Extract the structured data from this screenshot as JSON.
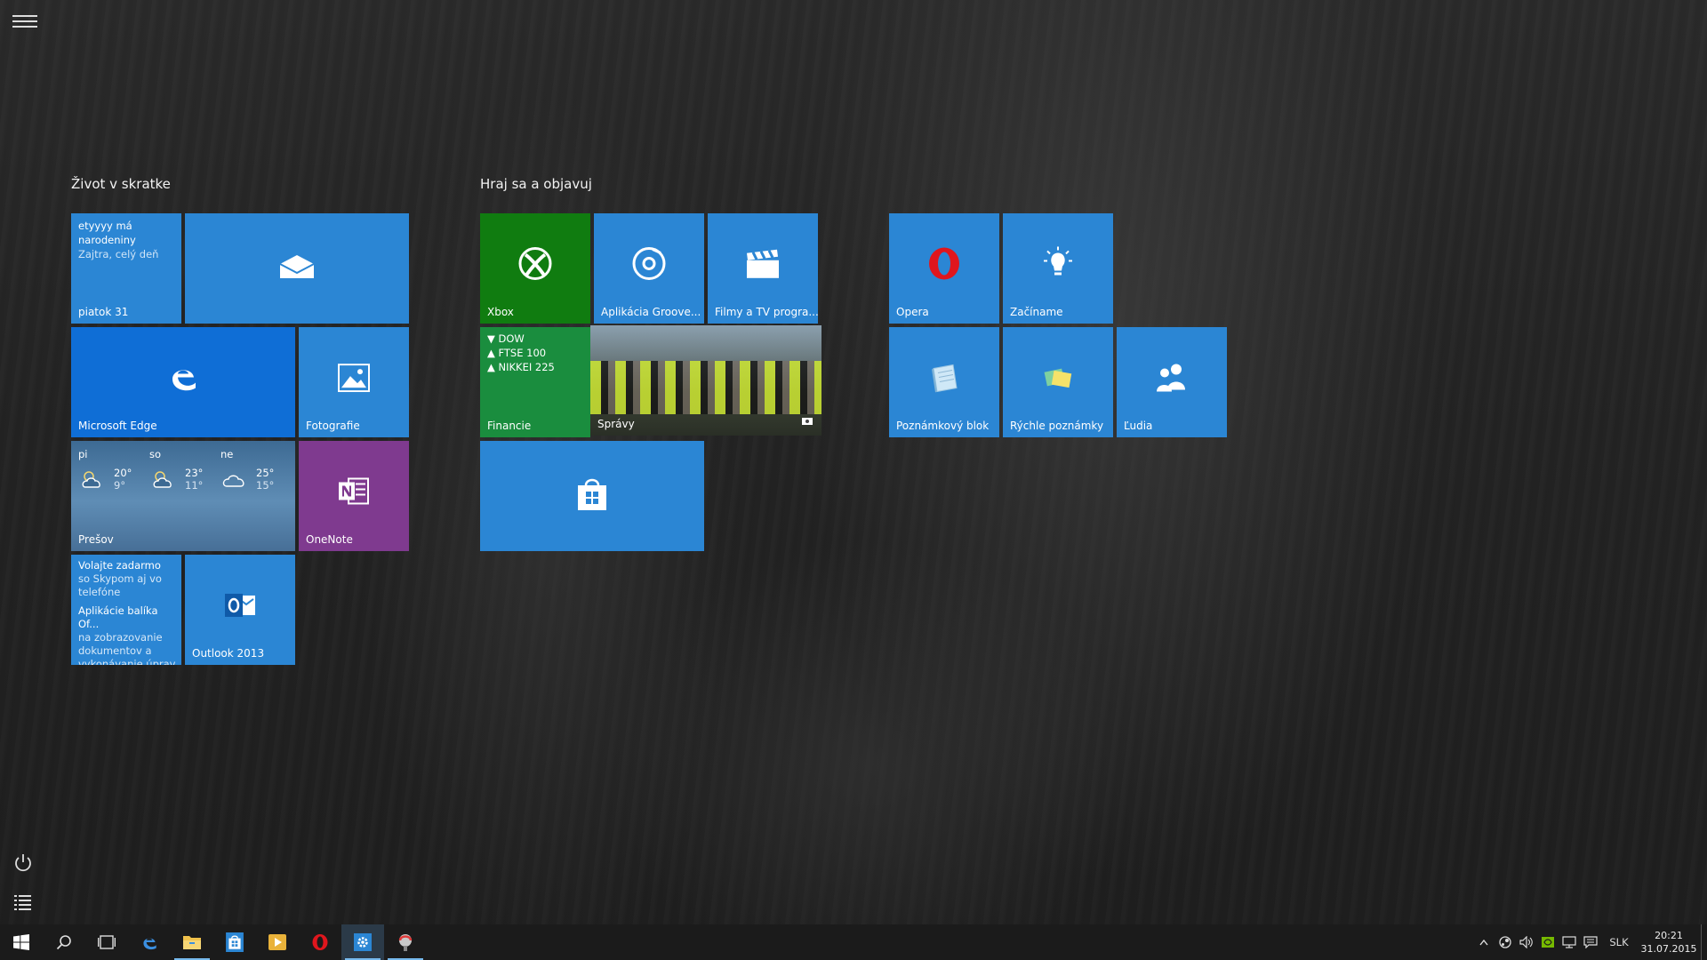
{
  "start": {
    "groups": [
      {
        "title": "Život v skratke"
      },
      {
        "title": "Hraj sa a objavuj"
      }
    ],
    "tiles": {
      "calendar": {
        "line1": "etyyyy má",
        "line2": "narodeniny",
        "line3": "Zajtra, celý deň",
        "label": "piatok 31"
      },
      "mail": {
        "label": ""
      },
      "edge": {
        "label": "Microsoft Edge"
      },
      "photos": {
        "label": "Fotografie"
      },
      "weather": {
        "days": [
          {
            "name": "pi",
            "high": "20°",
            "low": "9°"
          },
          {
            "name": "so",
            "high": "23°",
            "low": "11°"
          },
          {
            "name": "ne",
            "high": "25°",
            "low": "15°"
          }
        ],
        "label": "Prešov"
      },
      "onenote": {
        "label": "OneNote"
      },
      "skype": {
        "title": "Volajte zadarmo",
        "body": "so Skypom aj vo telefóne",
        "title2": "Aplikácie balíka Of...",
        "body2": "na zobrazovanie dokumentov a vykonávanie úprav"
      },
      "outlook": {
        "label": "Outlook 2013"
      },
      "xbox": {
        "label": "Xbox"
      },
      "groove": {
        "label": "Aplikácia Groove..."
      },
      "films": {
        "label": "Filmy a TV progra..."
      },
      "finance": {
        "items": [
          "▼ DOW",
          "▲ FTSE 100",
          "▲ NIKKEI 225"
        ],
        "label": "Financie"
      },
      "news": {
        "label": "Správy"
      },
      "store": {
        "label": ""
      },
      "opera": {
        "label": "Opera"
      },
      "getstarted": {
        "label": "Začíname"
      },
      "notepad": {
        "label": "Poznámkový blok"
      },
      "stickynotes": {
        "label": "Rýchle poznámky"
      },
      "people": {
        "label": "Ľudia"
      }
    }
  },
  "taskbar": {
    "apps": [
      "start-icon",
      "search-icon",
      "task-view-icon",
      "edge-icon",
      "file-explorer-icon",
      "store-icon",
      "media-player-icon",
      "opera-icon",
      "settings-icon",
      "app-icon"
    ],
    "tray": {
      "language": "SLK",
      "time": "20:21",
      "date": "31.07.2015"
    }
  },
  "colors": {
    "tile_blue": "#2b86d4",
    "edge_blue": "#0f6ed6",
    "xbox_green": "#107c10",
    "finance_green": "#1a8d3e",
    "onenote_purple": "#7f3a8f",
    "taskbar": "#1b1b1b",
    "accent": "#76b9ed"
  }
}
